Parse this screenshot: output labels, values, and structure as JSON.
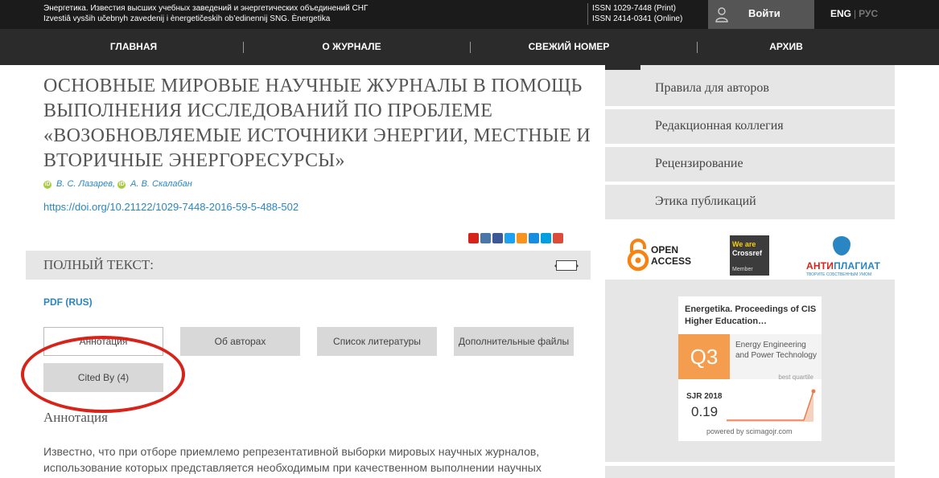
{
  "header": {
    "journal_line1": "Энергетика. Известия высших учебных заведений и энергетических объединений СНГ",
    "journal_line2": "Izvestiâ vysših učebnyh zavedenij i ènergetičeskih ob’edinennij SNG. Ènergetika",
    "issn_print": "ISSN 1029-7448 (Print)",
    "issn_online": "ISSN 2414-0341 (Online)",
    "login_label": "Войти",
    "lang_en": "ENG",
    "lang_sep": "|",
    "lang_ru": "РУС"
  },
  "nav": {
    "items": [
      "ГЛАВНАЯ",
      "О ЖУРНАЛЕ",
      "СВЕЖИЙ НОМЕР",
      "АРХИВ"
    ]
  },
  "article": {
    "title": "ОСНОВНЫЕ МИРОВЫЕ НАУЧНЫЕ ЖУРНАЛЫ В ПОМОЩЬ ВЫПОЛНЕНИЯ ИССЛЕДОВАНИЙ ПО ПРОБЛЕМЕ «ВОЗОБНОВЛЯЕМЫЕ ИСТОЧНИКИ ЭНЕРГИИ, МЕСТНЫЕ И ВТОРИЧНЫЕ ЭНЕРГОРЕСУРСЫ»",
    "author1": "В. С. Лазарев",
    "author_sep": ",",
    "author2": "А. В. Скалабан",
    "orcid_glyph": "iD",
    "doi": "https://doi.org/10.21122/1029-7448-2016-59-5-488-502",
    "fulltext_label": "ПОЛНЫЙ ТЕКСТ:",
    "pdf_label": "PDF (RUS)",
    "tabs": [
      "Аннотация",
      "Об авторах",
      "Список литературы",
      "Дополнительные файлы",
      "Cited By (4)"
    ],
    "abstract_heading": "Аннотация",
    "abstract_text": "Известно, что при отборе приемлемо репрезентативной выборки мировых научных журналов, использование которых представляется необходимым при качественном выполнении научных"
  },
  "share_icons": [
    "mail-ru-icon",
    "vk-icon",
    "facebook-icon",
    "twitter-icon",
    "odnoklassniki-icon",
    "moi-mir-icon",
    "livejournal-icon",
    "google-plus-icon"
  ],
  "share_colors": [
    "#d8231b",
    "#4a76a8",
    "#3b5998",
    "#1da1f2",
    "#f7931e",
    "#168de2",
    "#00a0e0",
    "#dd4b39"
  ],
  "sidebar": {
    "items": [
      "Правила для авторов",
      "Редакционная коллегия",
      "Рецензирование",
      "Этика публикаций"
    ],
    "open_access_line1": "OPEN",
    "open_access_line2": "ACCESS",
    "crossref_line1": "We are",
    "crossref_line2": "Crossref",
    "crossref_member": "Member",
    "antiplagiat_a": "АНТИ",
    "antiplagiat_b": "ПЛАГИАТ",
    "antiplagiat_tagline": "ТВОРИТЕ СОБСТВЕННЫМ УМОМ"
  },
  "sjr": {
    "journal": "Energetika. Proceedings of CIS Higher Education…",
    "quartile": "Q3",
    "category": "Energy Engineering and Power Technology",
    "best_quartile_label": "best quartile",
    "year_label": "SJR 2018",
    "value": "0.19",
    "powered_by": "powered by scimagojr.com"
  },
  "colors": {
    "topbar": "#1b1b1b",
    "nav": "#2b2b2b",
    "link": "#2a86c3",
    "highlight_oval": "#d8231b",
    "quartile": "#f59d4f",
    "sidebar_bg": "#e6e6e6"
  }
}
